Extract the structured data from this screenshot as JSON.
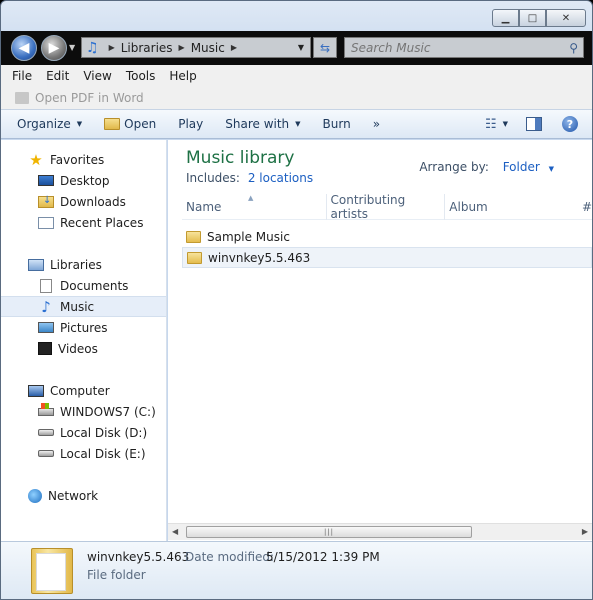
{
  "window": {
    "captions": {
      "minimize": "▁",
      "maximize": "□",
      "close": "✕"
    }
  },
  "address": {
    "crumbs": [
      "Libraries",
      "Music"
    ],
    "search_placeholder": "Search Music",
    "icons": {
      "back": "back-arrow-icon",
      "forward": "forward-arrow-icon",
      "refresh": "refresh-icon",
      "search": "magnifier-icon"
    }
  },
  "menubar": {
    "items": [
      "File",
      "Edit",
      "View",
      "Tools",
      "Help"
    ]
  },
  "pdfbar": {
    "label": "Open PDF in Word"
  },
  "commandbar": {
    "organize": "Organize",
    "open": "Open",
    "play": "Play",
    "share_with": "Share with",
    "burn": "Burn",
    "more": "»"
  },
  "navpane": {
    "favorites": "Favorites",
    "desktop": "Desktop",
    "downloads": "Downloads",
    "recent_places": "Recent Places",
    "libraries": "Libraries",
    "documents": "Documents",
    "music": "Music",
    "pictures": "Pictures",
    "videos": "Videos",
    "computer": "Computer",
    "drive_c": "WINDOWS7 (C:)",
    "drive_d": "Local Disk (D:)",
    "drive_e": "Local Disk (E:)",
    "network": "Network"
  },
  "content": {
    "title": "Music library",
    "includes_label": "Includes:",
    "includes_link": "2 locations",
    "arrange_label": "Arrange by:",
    "arrange_value": "Folder",
    "columns": {
      "name": "Name",
      "artists": "Contributing artists",
      "album": "Album",
      "more": "#"
    },
    "rows": [
      "Sample Music",
      "winvnkey5.5.463"
    ],
    "selected_row": "winvnkey5.5.463"
  },
  "details": {
    "name": "winvnkey5.5.463",
    "modified_label": "Date modified:",
    "modified_value": "5/15/2012 1:39 PM",
    "type": "File folder"
  },
  "colors": {
    "accent": "#1c5fc2",
    "library_title": "#1e7145",
    "address_bg": "#0c0c0c"
  }
}
